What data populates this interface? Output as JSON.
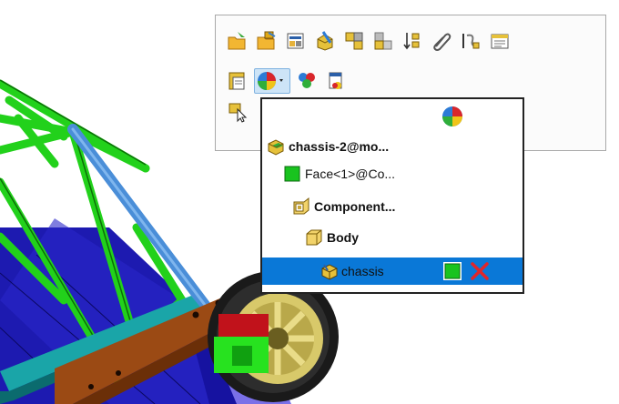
{
  "toolbar": {
    "row1_icons": [
      "open-part-icon",
      "open-assembly-icon",
      "component-properties-icon",
      "edit-component-icon",
      "isolate-icon",
      "hide-components-icon",
      "rebuild-icon",
      "mate-icon",
      "reference-icon",
      "properties-icon"
    ],
    "row2_icons": [
      "configuration-icon",
      "appearance-dropdown-icon",
      "multi-color-icon",
      "document-icon"
    ],
    "row3_icons": [
      "select-other-icon"
    ]
  },
  "selection_list": {
    "header_icon": "appearance-sphere-icon",
    "items": [
      {
        "label": "chassis-2@mo...",
        "icon": "assembly-icon",
        "bold": true
      },
      {
        "label": "Face<1>@Co...",
        "icon": "face-icon",
        "bold": false
      },
      {
        "label": "Component...",
        "icon": "component-icon",
        "bold": true
      },
      {
        "label": "Body",
        "icon": "body-icon",
        "bold": true
      },
      {
        "label": "chassis",
        "icon": "part-icon",
        "bold": false,
        "selected": true
      }
    ]
  },
  "colors": {
    "frame_green": "#22d11b",
    "selected_tube": "#4a8ed8",
    "floor_blue": "#1d1ab0",
    "rail_teal": "#1aa5a8",
    "rail_brown": "#9b4a14",
    "wheel_yellow": "#d8c96a",
    "highlight": "#0a78d7"
  }
}
